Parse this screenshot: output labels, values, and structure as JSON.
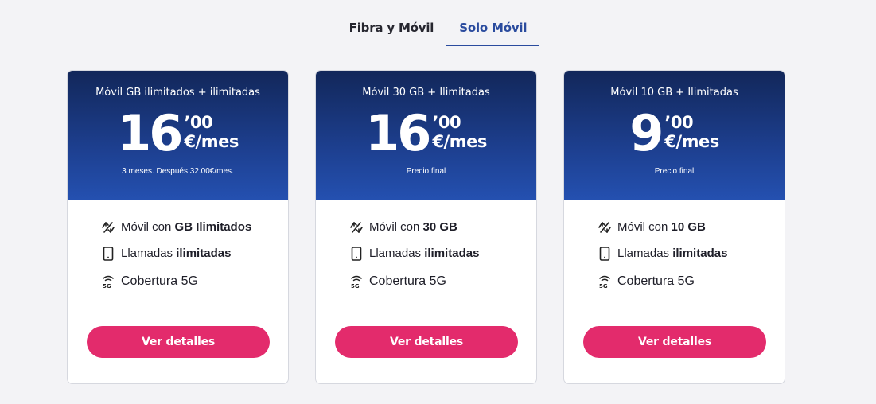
{
  "tabs": [
    {
      "label": "Fibra y Móvil",
      "active": false
    },
    {
      "label": "Solo Móvil",
      "active": true
    }
  ],
  "colors": {
    "accent": "#2a4b9e",
    "cta": "#e32b6c",
    "header_top": "#12275a",
    "header_bottom": "#2450b0"
  },
  "plans": [
    {
      "name": "Móvil GB ilimitados + ilimitadas",
      "price_int": "16",
      "price_cents": "’00",
      "price_unit": "€/mes",
      "note": "3 meses. Después 32.00€/mes.",
      "features": [
        {
          "icon": "data-arrows-icon",
          "prefix": "Móvil con ",
          "bold": "GB Ilimitados"
        },
        {
          "icon": "phone-icon",
          "prefix": "Llamadas ",
          "bold": "ilimitadas"
        },
        {
          "icon": "5g-icon",
          "prefix": "Cobertura 5G",
          "bold": ""
        }
      ],
      "cta": "Ver detalles"
    },
    {
      "name": "Móvil 30 GB + Ilimitadas",
      "price_int": "16",
      "price_cents": "’00",
      "price_unit": "€/mes",
      "note": "Precio final",
      "features": [
        {
          "icon": "data-arrows-icon",
          "prefix": "Móvil con ",
          "bold": "30 GB"
        },
        {
          "icon": "phone-icon",
          "prefix": "Llamadas ",
          "bold": "ilimitadas"
        },
        {
          "icon": "5g-icon",
          "prefix": "Cobertura 5G",
          "bold": ""
        }
      ],
      "cta": "Ver detalles"
    },
    {
      "name": "Móvil 10 GB + Ilimitadas",
      "price_int": "9",
      "price_cents": "’00",
      "price_unit": "€/mes",
      "note": "Precio final",
      "features": [
        {
          "icon": "data-arrows-icon",
          "prefix": "Móvil con ",
          "bold": "10 GB"
        },
        {
          "icon": "phone-icon",
          "prefix": "Llamadas ",
          "bold": "ilimitadas"
        },
        {
          "icon": "5g-icon",
          "prefix": "Cobertura 5G",
          "bold": ""
        }
      ],
      "cta": "Ver detalles"
    }
  ]
}
